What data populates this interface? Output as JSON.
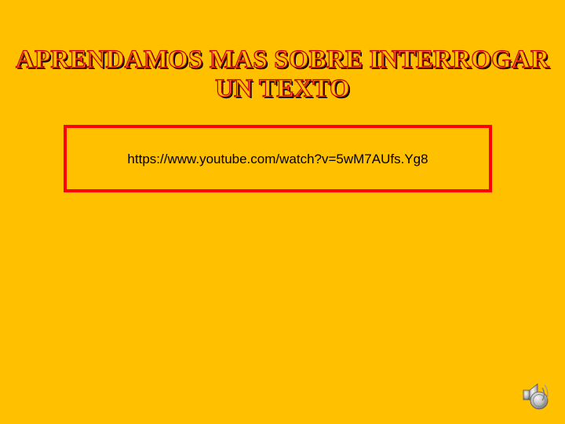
{
  "slide": {
    "title_line1": "APRENDAMOS MAS SOBRE INTERROGAR",
    "title_line2": "UN TEXTO",
    "link_text": "https://www.youtube.com/watch?v=5wM7AUfs.Yg8"
  },
  "colors": {
    "background": "#FFC000",
    "box_border": "#FF0000",
    "title_stroke": "#C00000",
    "title_shadow": "#000000"
  },
  "icons": {
    "audio": "speaker-icon"
  }
}
